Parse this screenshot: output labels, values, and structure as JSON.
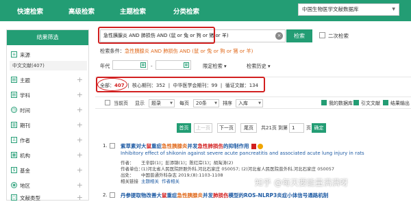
{
  "nav": {
    "items": [
      "快速检索",
      "高级检索",
      "主题检索",
      "分类检索"
    ],
    "database": "中国生物医学文献数据库"
  },
  "sidebar": {
    "title": "结果筛选",
    "source_label": "来源",
    "source_sub": "中文文献(407)",
    "facets": [
      "主题",
      "学科",
      "时间",
      "期刊",
      "作者",
      "机构",
      "基金",
      "地区",
      "文献类型"
    ]
  },
  "search": {
    "query": "急性胰腺炎 AND 肺损伤 AND (鼠 or 兔 or 狗 or 猪 or 羊)",
    "button": "检索",
    "secondary": "二次检索",
    "condition_prefix": "检索条件：",
    "condition": "急性胰腺炎 AND 肺损伤 AND (鼠 or 兔 or 狗 or 猪 or 羊)",
    "year_label": "年代",
    "year_sep": "-",
    "limit": "限定检索",
    "history": "检索历史"
  },
  "stats": {
    "total_label": "全部：",
    "total": "407",
    "core_label": "核心期刊：",
    "core": "352",
    "cma_label": "中华医学会期刊：",
    "cma": "99",
    "cite_label": "循证文献：",
    "cite": "134"
  },
  "toolbar": {
    "current_page": "当前页",
    "display_label": "显示",
    "display_value": "题录",
    "per_page_label": "每页",
    "per_page_value": "20条",
    "sort_label": "排序",
    "sort_value": "入库",
    "my_db": "我的数据库",
    "cite_doc": "引文文献",
    "export": "结果输出"
  },
  "pager": {
    "first": "首页",
    "prev": "上一页",
    "next": "下一页",
    "last": "尾页",
    "total_pages": "共21页",
    "goto": "到第",
    "page_input": "1",
    "page_unit": "页",
    "confirm": "确定"
  },
  "results": [
    {
      "num": "1.",
      "title_parts": [
        {
          "t": "紫草素对大",
          "c": ""
        },
        {
          "t": "鼠",
          "c": "r"
        },
        {
          "t": "重症",
          "c": ""
        },
        {
          "t": "急性胰腺炎",
          "c": "o"
        },
        {
          "t": "并发",
          "c": ""
        },
        {
          "t": "急性肺损伤",
          "c": "r"
        },
        {
          "t": "的抑制作用",
          "c": ""
        }
      ],
      "subtitle": "Inhibitory effect of shikonin against severe acute pancreatitis and associated acute lung injury in rats",
      "author_key": "作者：",
      "author_val": "王辛龄(1)；彭添锦(1)；陈红岸(1)；胡淘涛(2)",
      "unit_key": "作者单位：",
      "unit_val": "(1)河北省人民医院肝胆外科,河北石家庄 050057; (2)河北省人民医院普外科,河北石家庄 050057",
      "source_key": "出处：",
      "source_val": "中国普通外科杂志 2019;(8):1103-1108",
      "links": [
        "相关链接",
        "主题相关",
        "作者相关"
      ]
    },
    {
      "num": "2.",
      "title_parts": [
        {
          "t": "丹参提取物改善大",
          "c": ""
        },
        {
          "t": "鼠",
          "c": "r"
        },
        {
          "t": "重症",
          "c": ""
        },
        {
          "t": "急性胰腺炎",
          "c": "o"
        },
        {
          "t": "并发",
          "c": ""
        },
        {
          "t": "肺损伤",
          "c": "r"
        },
        {
          "t": "模型的ROS-NLRP3炎症小体信号通路机制",
          "c": ""
        }
      ]
    }
  ],
  "watermark": "知乎 @每天要能量满满呀"
}
